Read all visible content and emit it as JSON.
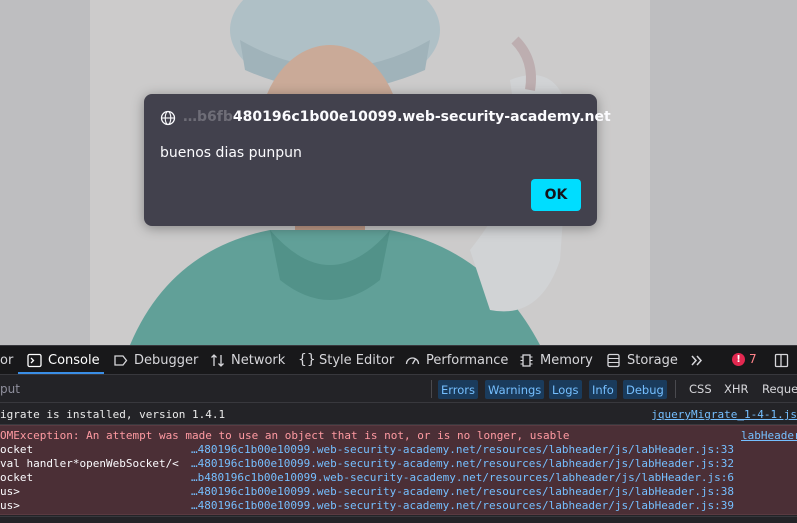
{
  "dialog": {
    "origin_faded": "…b6fb",
    "origin": "480196c1b00e10099.web-security-academy.net",
    "message": "buenos dias punpun",
    "ok_label": "OK"
  },
  "devtools": {
    "tabs": [
      {
        "label": "Console",
        "icon": "console-icon"
      },
      {
        "label": "Debugger",
        "icon": "debugger-icon"
      },
      {
        "label": "Network",
        "icon": "network-icon"
      },
      {
        "label": "Style Editor",
        "icon": "style-editor-icon"
      },
      {
        "label": "Performance",
        "icon": "performance-icon"
      },
      {
        "label": "Memory",
        "icon": "memory-icon"
      },
      {
        "label": "Storage",
        "icon": "storage-icon"
      }
    ],
    "partial_tab": "or",
    "error_count": "7",
    "filter_placeholder": "put",
    "filters": [
      "Errors",
      "Warnings",
      "Logs",
      "Info",
      "Debug"
    ],
    "extra_filters": [
      "CSS",
      "XHR",
      "Reque"
    ],
    "accent_color": "#3a8ee6"
  },
  "console": {
    "info_line": "igrate is installed, version 1.4.1",
    "info_link": "jqueryMigrate_1-4-1.js",
    "error_line": "OMException: An attempt was made to use an object that is not, or is no longer, usable",
    "error_link": "labHeader",
    "stack": [
      {
        "fn": "ocket",
        "loc": "…480196c1b00e10099.web-security-academy.net/resources/labheader/js/labHeader.js:33"
      },
      {
        "fn": "val handler*openWebSocket/<",
        "loc": "…480196c1b00e10099.web-security-academy.net/resources/labheader/js/labHeader.js:32"
      },
      {
        "fn": "ocket",
        "loc": "…b480196c1b00e10099.web-security-academy.net/resources/labheader/js/labHeader.js:6"
      },
      {
        "fn": "us>",
        "loc": "…480196c1b00e10099.web-security-academy.net/resources/labheader/js/labHeader.js:38"
      },
      {
        "fn": "us>",
        "loc": "…480196c1b00e10099.web-security-academy.net/resources/labheader/js/labHeader.js:39"
      }
    ]
  }
}
